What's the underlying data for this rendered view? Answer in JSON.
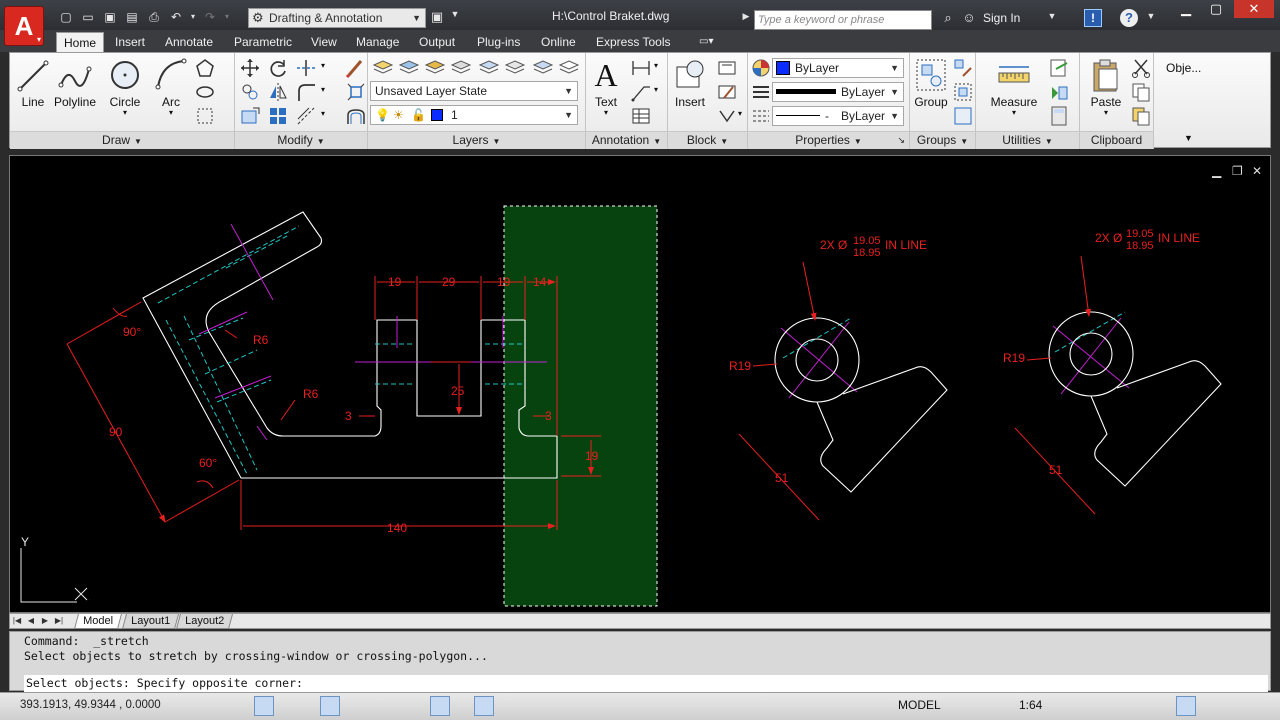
{
  "title_bar": {
    "workspace": "Drafting & Annotation",
    "document_title": "H:\\Control Braket.dwg",
    "search_placeholder": "Type a keyword or phrase",
    "sign_in": "Sign In"
  },
  "ribbon_tabs": [
    "Home",
    "Insert",
    "Annotate",
    "Parametric",
    "View",
    "Manage",
    "Output",
    "Plug-ins",
    "Online",
    "Express Tools"
  ],
  "active_tab": "Home",
  "panels": {
    "draw": {
      "title": "Draw",
      "tools": [
        "Line",
        "Polyline",
        "Circle",
        "Arc"
      ]
    },
    "modify": {
      "title": "Modify"
    },
    "layers": {
      "title": "Layers",
      "layer_state": "Unsaved Layer State",
      "current_layer": "1"
    },
    "annotation": {
      "title": "Annotation",
      "text_tool": "Text"
    },
    "block": {
      "title": "Block",
      "insert_tool": "Insert"
    },
    "properties": {
      "title": "Properties",
      "color": "ByLayer",
      "lineweight": "ByLayer",
      "linetype": "ByLayer"
    },
    "groups": {
      "title": "Groups",
      "group_tool": "Group"
    },
    "utilities": {
      "title": "Utilities",
      "measure_tool": "Measure"
    },
    "clipboard": {
      "title": "Clipboard",
      "paste_tool": "Paste"
    },
    "overflow": {
      "label": "Obje..."
    }
  },
  "drawing": {
    "dims": {
      "d19a": "19",
      "d29": "29",
      "d19b": "19",
      "d14": "14",
      "d25": "25",
      "d3a": "3",
      "d3b": "3",
      "d19c": "19",
      "d140": "140",
      "d90": "90",
      "a90": "90°",
      "a60": "60°",
      "r6a": "R6",
      "r6b": "R6",
      "r19a": "R19",
      "r19b": "R19",
      "d51a": "51",
      "d51b": "51",
      "hole_prefix": "2X Ø",
      "hole_upper": "19.05",
      "hole_lower": "18.95",
      "hole_suffix": "IN LINE"
    },
    "ucs_y": "Y",
    "ucs_x": "X"
  },
  "layout_tabs": [
    "Model",
    "Layout1",
    "Layout2"
  ],
  "active_layout": "Model",
  "command_line": {
    "history": [
      "Command:  _stretch",
      "Select objects to stretch by crossing-window or crossing-polygon..."
    ],
    "prompt": "Select objects: Specify opposite corner:"
  },
  "status_bar": {
    "coordinates": "393.1913, 49.9344 , 0.0000",
    "space": "MODEL",
    "annotation_scale": "1:64"
  },
  "colors": {
    "dimension": "#e8201f",
    "geometry": "#ffffff",
    "hidden": "#21c4c4",
    "centerline": "#c020d0",
    "selection": "#0a5a14",
    "accent": "#d8281f"
  }
}
